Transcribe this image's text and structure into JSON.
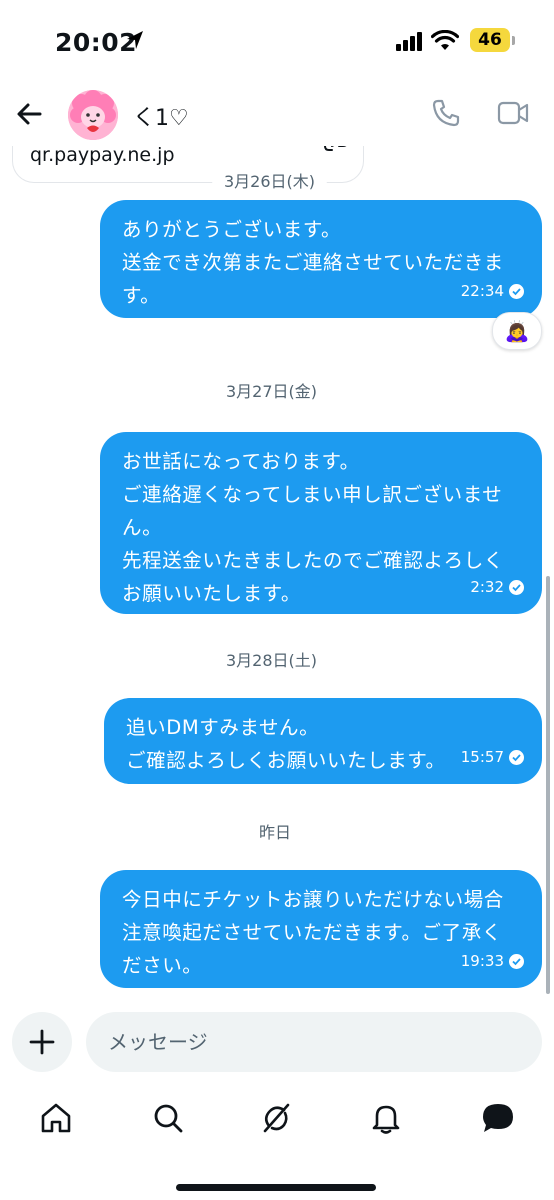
{
  "status_bar": {
    "time": "20:02",
    "battery": "46"
  },
  "header": {
    "contact_name": "く1♡"
  },
  "link_card": {
    "url": "qr.paypay.ne.jp"
  },
  "messages": [
    {
      "date": "3月26日(木)"
    },
    {
      "text": "ありがとうございます。\n送金でき次第またご連絡させていただきま\nす。",
      "time": "22:34",
      "reaction": "🙇‍♀️"
    },
    {
      "date": "3月27日(金)"
    },
    {
      "text": "お世話になっております。\nご連絡遅くなってしまい申し訳ございませ\nん。\n先程送金いたきましたのでご確認よろしく\nお願いいたします。",
      "time": "2:32"
    },
    {
      "date": "3月28日(土)"
    },
    {
      "text": "追いDMすみません。\nご確認よろしくお願いいたします。",
      "time": "15:57"
    },
    {
      "date": "昨日"
    },
    {
      "text": "今日中にチケットお譲りいただけない場合\n注意喚起ださせていただきます。ご了承く\nださい。",
      "time": "19:33"
    }
  ],
  "composer": {
    "placeholder": "メッセージ"
  },
  "icons": {
    "back": "arrow-left-icon",
    "phone": "phone-icon",
    "video": "video-camera-icon",
    "add": "plus-icon",
    "home": "home-icon",
    "search": "search-icon",
    "grok": "grok-icon",
    "notifications": "bell-icon",
    "messages": "message-icon"
  },
  "colors": {
    "accent": "#1d9bf0",
    "battery": "#f5d83d",
    "muted_text": "#536471"
  }
}
